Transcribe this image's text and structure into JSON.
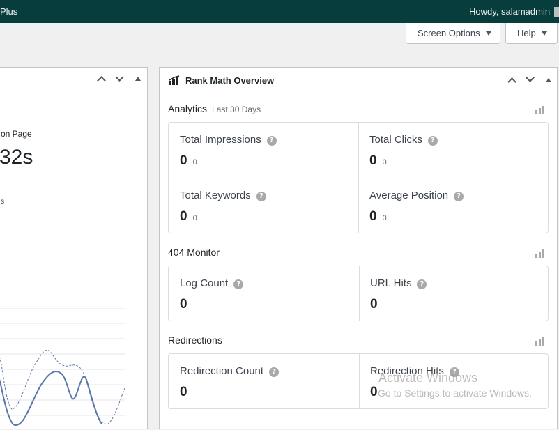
{
  "admin_bar": {
    "left_text": "Plus",
    "howdy": "Howdy, salamadmin"
  },
  "screen_meta": {
    "screen_options": "Screen Options",
    "help": "Help"
  },
  "left_widget": {
    "label_1": "on Page",
    "big_value": "32s",
    "label_2": "s"
  },
  "rank_math": {
    "title": "Rank Math Overview",
    "analytics": {
      "title": "Analytics",
      "subtitle": "Last 30 Days",
      "metrics": [
        {
          "label": "Total Impressions",
          "value": "0",
          "diff": "0"
        },
        {
          "label": "Total Clicks",
          "value": "0",
          "diff": "0"
        },
        {
          "label": "Total Keywords",
          "value": "0",
          "diff": "0"
        },
        {
          "label": "Average Position",
          "value": "0",
          "diff": "0"
        }
      ]
    },
    "monitor": {
      "title": "404 Monitor",
      "metrics": [
        {
          "label": "Log Count",
          "value": "0"
        },
        {
          "label": "URL Hits",
          "value": "0"
        }
      ]
    },
    "redirections": {
      "title": "Redirections",
      "metrics": [
        {
          "label": "Redirection Count",
          "value": "0"
        },
        {
          "label": "Redirection Hits",
          "value": "0"
        }
      ]
    }
  },
  "watermark": {
    "line1": "Activate Windows",
    "line2": "Go to Settings to activate Windows."
  },
  "help_glyph": "?",
  "colors": {
    "admin_bar": "#083d3d",
    "page_bg": "#f0f0f1",
    "chart_line": "#5b76a8"
  }
}
